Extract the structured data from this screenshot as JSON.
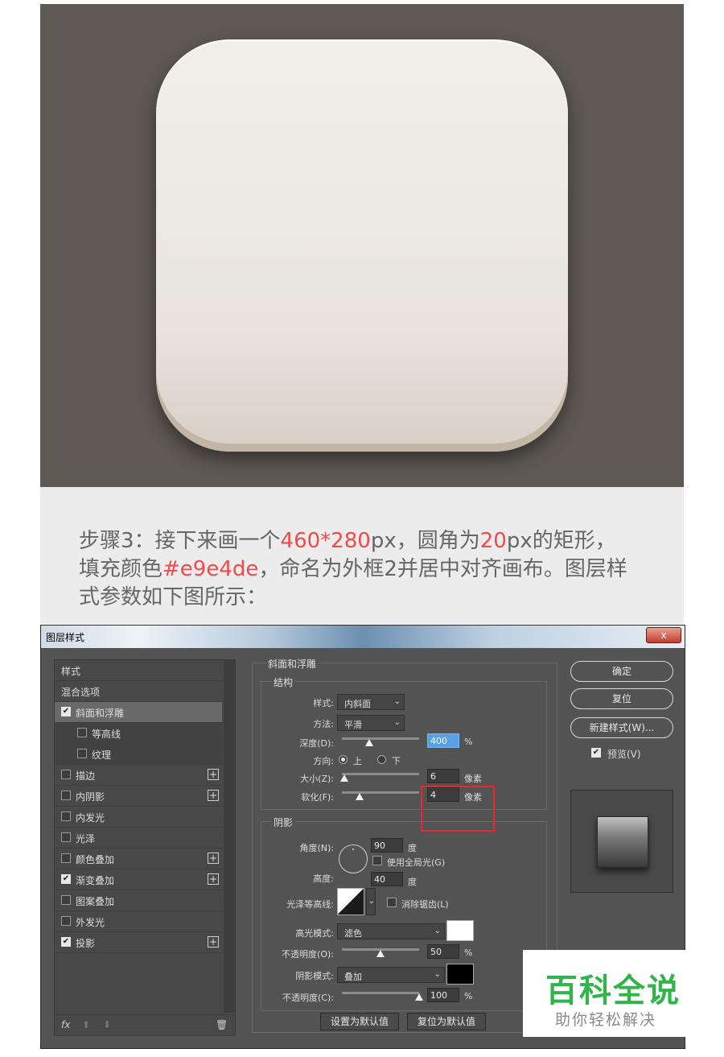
{
  "instruction": {
    "line1_a": "步骤3：接下来画一个",
    "size": "460*280",
    "line1_b": "px，圆角为",
    "radius": "20",
    "line1_c": "px的矩形，",
    "line2_a": "填充颜色",
    "color": "#e9e4de",
    "line2_b": "，命名为外框2并居中对齐画布。图层样",
    "line3": "式参数如下图所示："
  },
  "dialog": {
    "title": "图层样式",
    "close": "x",
    "left_panel": {
      "items": [
        {
          "label": "样式"
        },
        {
          "label": "混合选项"
        },
        {
          "label": "斜面和浮雕",
          "checked": true
        },
        {
          "label": "等高线",
          "checked": false
        },
        {
          "label": "纹理",
          "checked": false
        },
        {
          "label": "描边",
          "checked": false
        },
        {
          "label": "内阴影",
          "checked": false
        },
        {
          "label": "内发光",
          "checked": false
        },
        {
          "label": "光泽",
          "checked": false
        },
        {
          "label": "颜色叠加",
          "checked": false
        },
        {
          "label": "渐变叠加",
          "checked": true
        },
        {
          "label": "图案叠加",
          "checked": false
        },
        {
          "label": "外发光",
          "checked": false
        },
        {
          "label": "投影",
          "checked": true
        }
      ],
      "checkmark": "✔",
      "plus": "+",
      "footer": {
        "fx": "fx",
        "up": "⬆",
        "down": "⬇",
        "trash": "🗑"
      }
    },
    "bevel": {
      "title": "斜面和浮雕",
      "structure_title": "结构",
      "style_label": "样式:",
      "style_value": "内斜面",
      "technique_label": "方法:",
      "technique_value": "平滑",
      "depth_label": "深度(D):",
      "depth_value": "400",
      "depth_pos": 0.35,
      "percent": "%",
      "direction_label": "方向:",
      "dir_up": "上",
      "dir_down": "下",
      "size_label": "大小(Z):",
      "size_value": "6",
      "size_pos": 0.03,
      "soften_label": "软化(F):",
      "soften_value": "4",
      "soften_pos": 0.23,
      "px_unit": "像素"
    },
    "shading": {
      "title": "阴影",
      "angle_label": "角度(N):",
      "angle_value": "90",
      "degree": "度",
      "global_light": "使用全局光(G)",
      "altitude_label": "高度:",
      "altitude_value": "40",
      "gloss_label": "光泽等高线:",
      "anti_alias": "消除锯齿(L)",
      "highlight_mode_label": "高光模式:",
      "highlight_mode": "滤色",
      "highlight_color": "#ffffff",
      "opacity1_label": "不透明度(O):",
      "opacity1_value": "50",
      "opacity1_pos": 0.5,
      "shadow_mode_label": "阴影模式:",
      "shadow_mode": "叠加",
      "shadow_color": "#000000",
      "opacity2_label": "不透明度(C):",
      "opacity2_value": "100",
      "opacity2_pos": 1.0
    },
    "make_default": "设置为默认值",
    "reset_default": "复位为默认值",
    "right": {
      "ok": "确定",
      "reset": "复位",
      "new_style": "新建样式(W)...",
      "preview": "预览(V)"
    }
  },
  "watermark": {
    "main": "百科全说",
    "sub": "助你轻松解决"
  }
}
